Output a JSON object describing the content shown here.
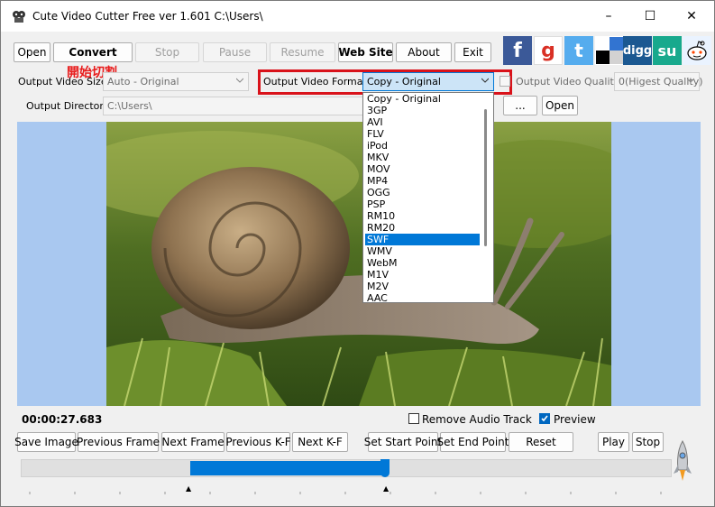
{
  "window": {
    "title": "Cute Video Cutter Free ver 1.601  C:\\Users\\",
    "minimize": "–",
    "maximize": "☐",
    "close": "✕"
  },
  "toolbar": {
    "open": "Open",
    "convert": "Convert",
    "stop": "Stop",
    "pause": "Pause",
    "resume": "Resume",
    "website": "Web Site",
    "about": "About",
    "exit": "Exit"
  },
  "social": {
    "facebook": "f",
    "google": "g",
    "twitter": "t",
    "digg": "digg",
    "stumbleupon": "su"
  },
  "annotation": "開始切割",
  "settings": {
    "size_label": "Output Video Size:",
    "size_value": "Auto - Original",
    "format_label": "Output Video Format:",
    "format_value": "Copy - Original",
    "quality_label": "Output Video Quality",
    "quality_value": "0(Higest Quality)",
    "dir_label": "Output Directory:",
    "dir_value": "C:\\Users\\",
    "browse": "...",
    "open_dir": "Open"
  },
  "format_options": [
    "Copy - Original",
    "3GP",
    "AVI",
    "FLV",
    "iPod",
    "MKV",
    "MOV",
    "MP4",
    "OGG",
    "PSP",
    "RM10",
    "RM20",
    "SWF",
    "WMV",
    "WebM",
    "M1V",
    "M2V",
    "AAC"
  ],
  "format_selected": "SWF",
  "playback": {
    "time": "00:00:27.683",
    "remove_audio": "Remove Audio Track",
    "preview": "Preview",
    "save_image": "Save Image",
    "prev_frame": "Previous Frame",
    "next_frame": "Next Frame",
    "prev_kf": "Previous K-F",
    "next_kf": "Next K-F",
    "set_start": "Set  Start Point",
    "set_end": "Set  End Point",
    "reset": "Reset",
    "play": "Play",
    "stop": "Stop"
  },
  "colors": {
    "highlight_box": "#d9121a",
    "annotation": "#e81b1b",
    "selection": "#0078d7",
    "video_bg": "#a9c8f0"
  }
}
